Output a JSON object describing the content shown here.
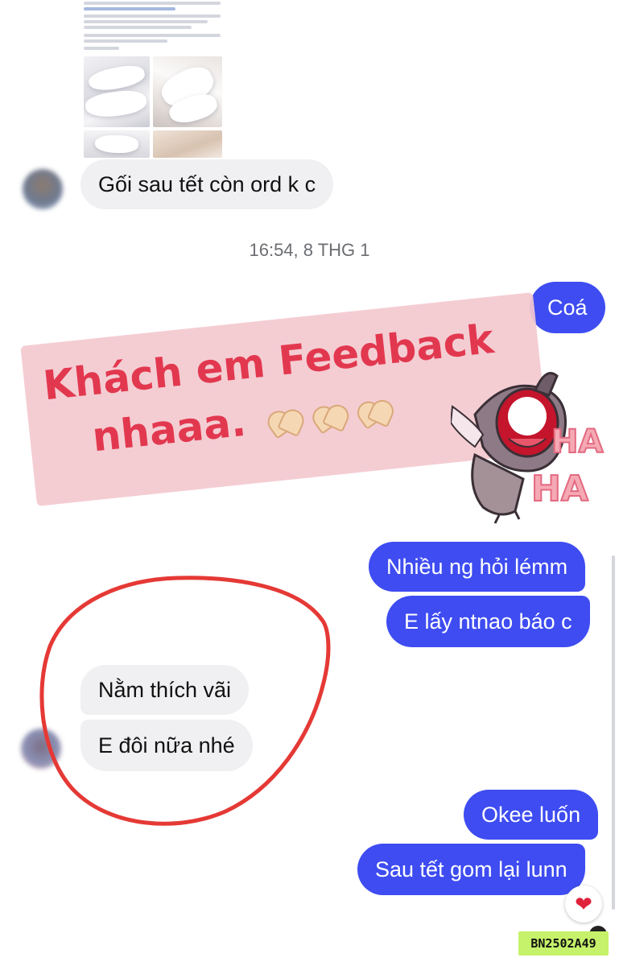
{
  "conversation": {
    "timestamp": "16:54, 8 THG 1",
    "messages": [
      {
        "id": "goi",
        "side": "incoming",
        "text": "Gối sau tết còn ord k c"
      },
      {
        "id": "coa",
        "side": "outgoing",
        "text": "Coá"
      },
      {
        "id": "nhieu",
        "side": "outgoing",
        "text": "Nhiều ng hỏi lémm"
      },
      {
        "id": "elay",
        "side": "outgoing",
        "text": "E lấy ntnao báo c"
      },
      {
        "id": "nam",
        "side": "incoming",
        "text": "Nằm thích vãi"
      },
      {
        "id": "edoi",
        "side": "incoming",
        "text": "E đôi nữa nhé"
      },
      {
        "id": "okee",
        "side": "outgoing",
        "text": "Okee luốn"
      },
      {
        "id": "sau",
        "side": "outgoing",
        "text": "Sau tết gom lại lunn"
      }
    ],
    "reaction": {
      "icon": "heart-icon",
      "glyph": "❤"
    }
  },
  "overlay": {
    "line1": "Khách em  Feedback",
    "line2": "nhaaa.",
    "emoji": "heart-hands-icon",
    "color": "#e2384f",
    "background": "#f3c9d0"
  },
  "sticker": {
    "icon": "laughing-character-sticker",
    "ha_top": "HA",
    "ha_bottom": "HA"
  },
  "annotation": {
    "shape": "hand-drawn-circle",
    "color": "#e53935"
  },
  "watermark": "BN2502A49",
  "colors": {
    "outgoing_bubble": "#3e4cf1",
    "incoming_bubble": "#f0f0f2",
    "timestamp": "#6b6d72"
  }
}
